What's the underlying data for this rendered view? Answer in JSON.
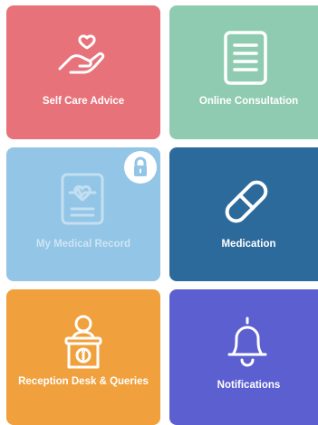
{
  "colors": {
    "self_care": "#e8727a",
    "consultation": "#8fcbb0",
    "medical_record": "#92c5e6",
    "medication": "#2d6a9c",
    "reception": "#f0a03c",
    "notifications": "#5b5fd0"
  },
  "tiles": [
    {
      "label": "Self Care Advice",
      "icon": "hand-heart-icon",
      "locked": false
    },
    {
      "label": "Online Consultation",
      "icon": "document-icon",
      "locked": false
    },
    {
      "label": "My Medical Record",
      "icon": "medical-record-icon",
      "locked": true
    },
    {
      "label": "Medication",
      "icon": "pill-icon",
      "locked": false
    },
    {
      "label": "Reception Desk & Queries",
      "icon": "reception-desk-icon",
      "locked": false
    },
    {
      "label": "Notifications",
      "icon": "bell-icon",
      "locked": false
    }
  ]
}
